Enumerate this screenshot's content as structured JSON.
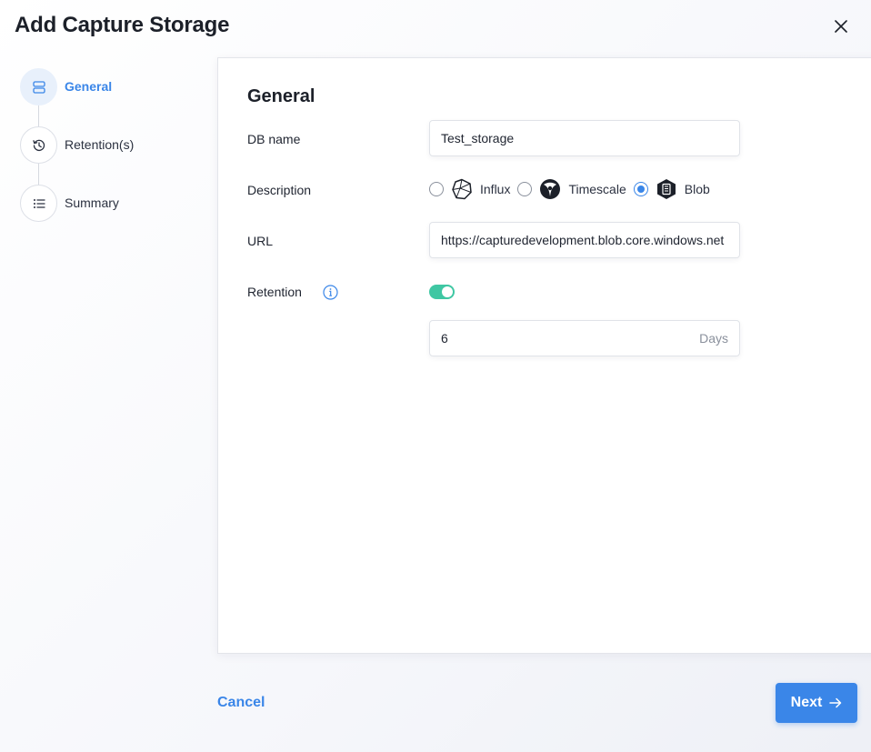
{
  "dialog": {
    "title": "Add Capture Storage"
  },
  "stepper": {
    "steps": [
      {
        "label": "General",
        "icon": "server-icon",
        "active": true
      },
      {
        "label": "Retention(s)",
        "icon": "history-icon",
        "active": false
      },
      {
        "label": "Summary",
        "icon": "list-icon",
        "active": false
      }
    ]
  },
  "form": {
    "section_title": "General",
    "db_name": {
      "label": "DB name",
      "value": "Test_storage"
    },
    "description": {
      "label": "Description",
      "options": [
        {
          "label": "Influx",
          "icon": "influx-logo-icon",
          "checked": false
        },
        {
          "label": "Timescale",
          "icon": "timescale-logo-icon",
          "checked": false
        },
        {
          "label": "Blob",
          "icon": "blob-logo-icon",
          "checked": true
        }
      ]
    },
    "url": {
      "label": "URL",
      "value": "https://capturedevelopment.blob.core.windows.net"
    },
    "retention": {
      "label": "Retention",
      "enabled": true,
      "value": "6",
      "unit": "Days"
    }
  },
  "footer": {
    "cancel_label": "Cancel",
    "next_label": "Next"
  },
  "colors": {
    "accent": "#3a86e8",
    "toggle_on": "#3fc7a3",
    "title": "#1c2029"
  }
}
